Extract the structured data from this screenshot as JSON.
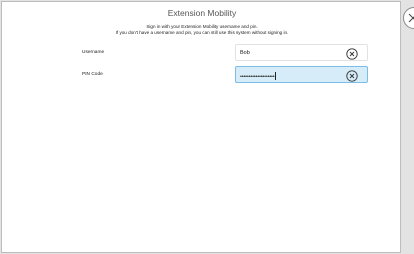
{
  "header": {
    "title": "Extension Mobility",
    "line1": "Sign in with your Extension Mobility username and pin.",
    "line2": "If you don't have a username and pin, you can still use this system without signing in."
  },
  "form": {
    "username": {
      "label": "Username",
      "value": "Bob"
    },
    "pin": {
      "label": "PIN Code",
      "value": "••••••••••••••••••••"
    }
  },
  "icons": {
    "clear": "close-circle-icon",
    "side": "close-icon"
  }
}
